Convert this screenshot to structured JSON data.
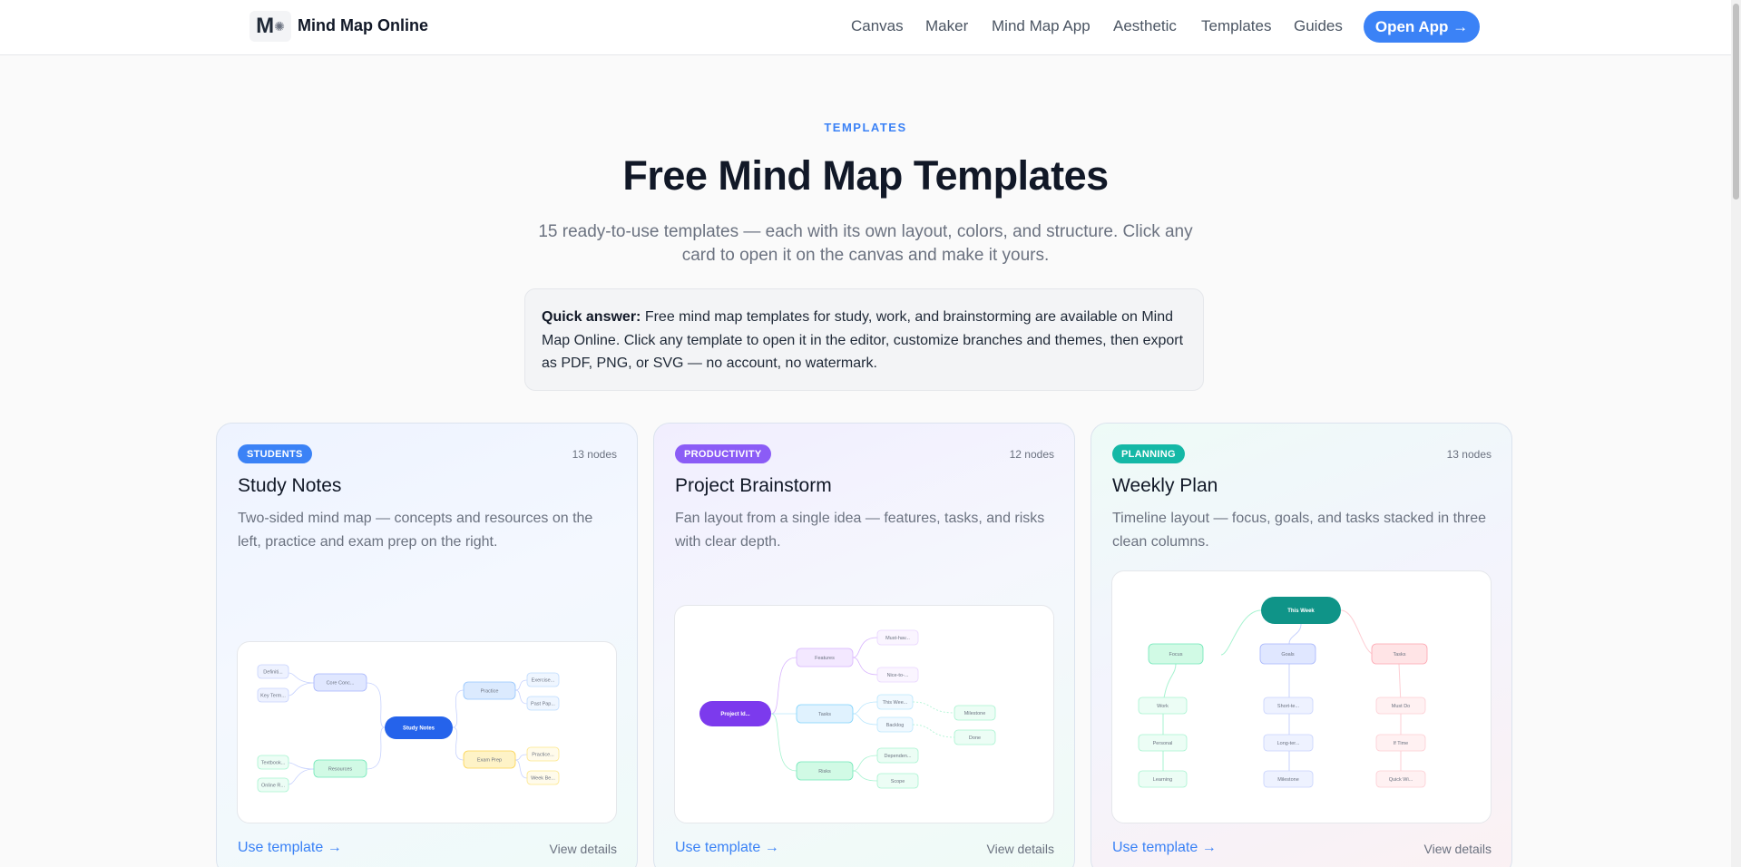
{
  "header": {
    "logo_letter": "M",
    "brand": "Mind Map Online",
    "nav": [
      "Canvas",
      "Maker",
      "Mind Map App",
      "Aesthetic",
      "Templates",
      "Guides"
    ],
    "cta": "Open App →"
  },
  "hero": {
    "eyebrow": "TEMPLATES",
    "title": "Free Mind Map Templates",
    "subtitle": "15 ready-to-use templates — each with its own layout, colors, and structure. Click any card to open it on the canvas and make it yours."
  },
  "quick_answer": {
    "label": "Quick answer:",
    "text": " Free mind map templates for study, work, and brainstorming are available on Mind Map Online. Click any template to open it in the editor, customize branches and themes, then export as PDF, PNG, or SVG — no account, no watermark."
  },
  "cards": [
    {
      "badge": "STUDENTS",
      "badge_color": "#3b82f6",
      "nodes": "13 nodes",
      "title": "Study Notes",
      "description": "Two-sided mind map — concepts and resources on the left, practice and exam prep on the right.",
      "use_label": "Use template →",
      "details_label": "View details",
      "preview": {
        "center": "Study Notes",
        "nodes": [
          "Definiti...",
          "Key Term...",
          "Core Conc...",
          "Textbook...",
          "Online R...",
          "Resources",
          "Practice",
          "Exercise...",
          "Past Pap...",
          "Exam Prep",
          "Practice...",
          "Week Be..."
        ]
      }
    },
    {
      "badge": "PRODUCTIVITY",
      "badge_color": "#8b5cf6",
      "nodes": "12 nodes",
      "title": "Project Brainstorm",
      "description": "Fan layout from a single idea — features, tasks, and risks with clear depth.",
      "use_label": "Use template →",
      "details_label": "View details",
      "preview": {
        "center": "Project Id...",
        "nodes": [
          "Features",
          "Must-hav...",
          "Nice-to-...",
          "Tasks",
          "This Wee...",
          "Backlog",
          "Milestone",
          "Done",
          "Risks",
          "Dependen...",
          "Scope"
        ]
      }
    },
    {
      "badge": "PLANNING",
      "badge_color": "#14b8a6",
      "nodes": "13 nodes",
      "title": "Weekly Plan",
      "description": "Timeline layout — focus, goals, and tasks stacked in three clean columns.",
      "use_label": "Use template →",
      "details_label": "View details",
      "preview": {
        "center": "This Week",
        "nodes": [
          "Focus",
          "Work",
          "Personal",
          "Learning",
          "Goals",
          "Short-te...",
          "Long-ter...",
          "Milestone",
          "Tasks",
          "Must Do",
          "If Time",
          "Quick Wi..."
        ]
      }
    }
  ]
}
